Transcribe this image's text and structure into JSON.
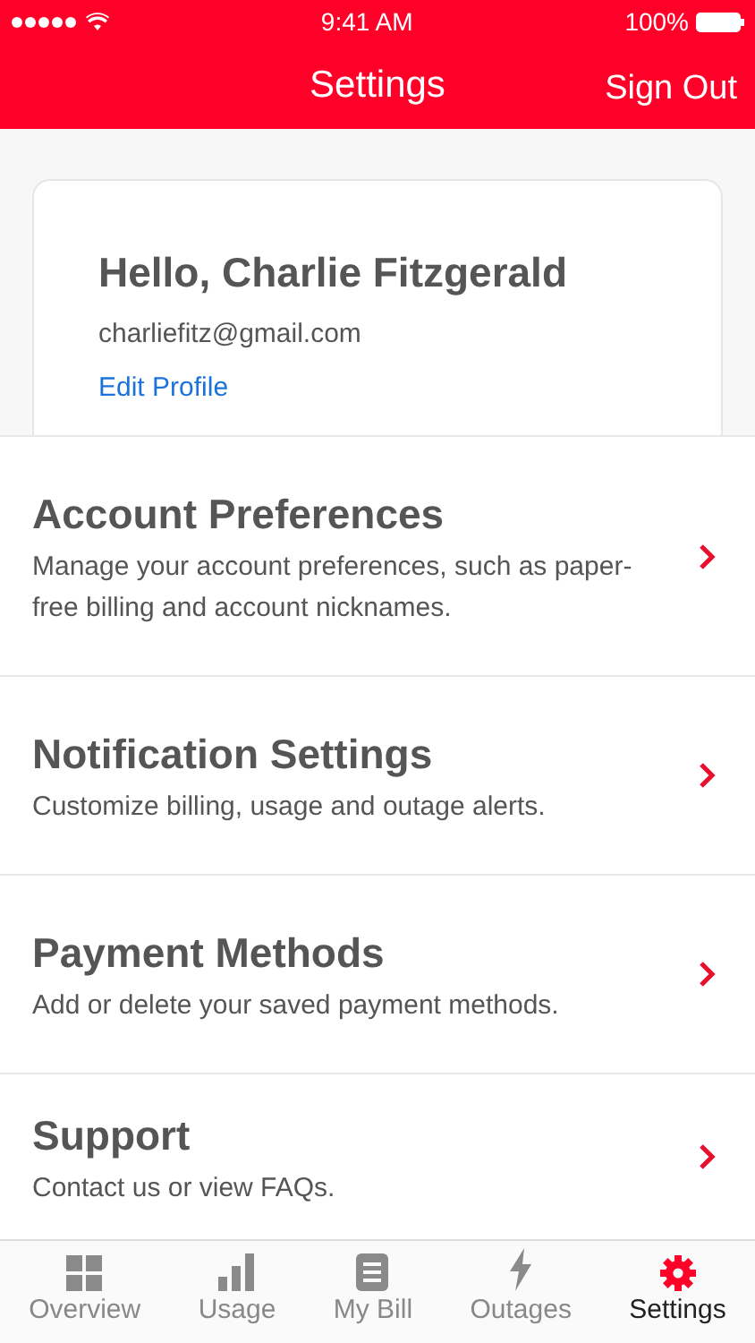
{
  "status_bar": {
    "time": "9:41 AM",
    "battery": "100%"
  },
  "nav": {
    "title": "Settings",
    "action": "Sign Out"
  },
  "profile": {
    "greeting": "Hello, Charlie Fitzgerald",
    "email": "charliefitz@gmail.com",
    "link": "Edit Profile"
  },
  "menu": [
    {
      "title": "Account Preferences",
      "description": "Manage your account preferences, such as paper-free billing and account nicknames."
    },
    {
      "title": "Notification Settings",
      "description": "Customize billing, usage and outage alerts."
    },
    {
      "title": "Payment Methods",
      "description": "Add or delete your saved payment methods."
    },
    {
      "title": "Support",
      "description": "Contact us or view FAQs."
    }
  ],
  "tabs": [
    {
      "label": "Overview",
      "kind": "grid",
      "selected": false
    },
    {
      "label": "Usage",
      "kind": "bars",
      "selected": false
    },
    {
      "label": "My Bill",
      "kind": "bill",
      "selected": false
    },
    {
      "label": "Outages",
      "kind": "bolt",
      "selected": false
    },
    {
      "label": "Settings",
      "kind": "gear",
      "selected": true
    }
  ]
}
